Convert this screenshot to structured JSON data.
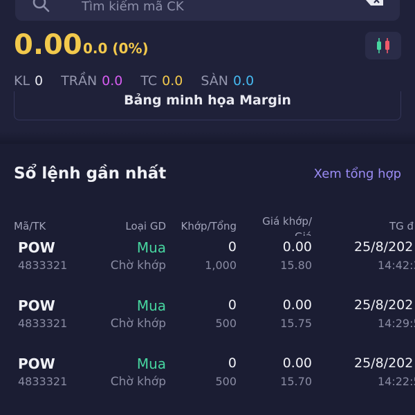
{
  "search": {
    "placeholder": "Tìm kiếm mã CK"
  },
  "quote": {
    "price": "0.00",
    "change": "0.0 (0%)",
    "stats": [
      {
        "label": "KL",
        "value": "0",
        "color": "#e8e9f0"
      },
      {
        "label": "TRẦN",
        "value": "0.0",
        "color": "#d55cf0"
      },
      {
        "label": "TC",
        "value": "0.0",
        "color": "#f2c94c"
      },
      {
        "label": "SÀN",
        "value": "0.0",
        "color": "#45b8ef"
      }
    ],
    "chart_icon": "candlestick-chart-icon"
  },
  "margin": {
    "label": "Bảng minh họa Margin"
  },
  "orders": {
    "title": "Sổ lệnh gần nhất",
    "view_all": "Xem tổng hợp",
    "columns": {
      "symbol": "Mã/TK",
      "type": "Loại GD",
      "match": "Khớp/Tổng",
      "price_line1": "Giá khớp/",
      "price_line2": "Giá",
      "time": "TG đ"
    },
    "rows": [
      {
        "symbol": "POW",
        "account": "4833321",
        "side": "Mua",
        "status": "Chờ khớp",
        "matched": "0",
        "total": "1,000",
        "match_price": "0.00",
        "order_price": "15.80",
        "date": "25/8/202",
        "time": "14:42:3"
      },
      {
        "symbol": "POW",
        "account": "4833321",
        "side": "Mua",
        "status": "Chờ khớp",
        "matched": "0",
        "total": "500",
        "match_price": "0.00",
        "order_price": "15.75",
        "date": "25/8/202",
        "time": "14:29:5"
      },
      {
        "symbol": "POW",
        "account": "4833321",
        "side": "Mua",
        "status": "Chờ khớp",
        "matched": "0",
        "total": "500",
        "match_price": "0.00",
        "order_price": "15.70",
        "date": "25/8/202",
        "time": "14:22:5"
      }
    ]
  },
  "colors": {
    "accent_yellow": "#f2c94c",
    "buy_green": "#47d6a0",
    "link_purple": "#9b8cf5",
    "background": "#1b1d33"
  }
}
